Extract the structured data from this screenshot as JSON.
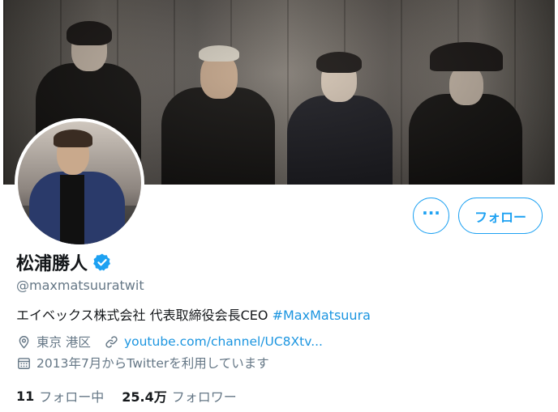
{
  "profile": {
    "display_name": "松浦勝人",
    "handle": "@maxmatsuuratwit",
    "bio_text": "エイベックス株式会社 代表取締役会長CEO ",
    "bio_hashtag": "#MaxMatsuura",
    "location": "東京 港区",
    "url": "youtube.com/channel/UC8Xtv...",
    "joined": "2013年7月からTwitterを利用しています"
  },
  "actions": {
    "more_label": "···",
    "follow_label": "フォロー"
  },
  "stats": {
    "following_count": "11",
    "following_label": "フォロー中",
    "followers_count": "25.4万",
    "followers_label": "フォロワー"
  },
  "icons": {
    "verified": "verified-badge-icon",
    "location": "location-pin-icon",
    "link": "link-icon",
    "calendar": "calendar-icon"
  },
  "colors": {
    "accent": "#1da1f2",
    "link": "#1b95e0",
    "secondary_text": "#657786",
    "primary_text": "#14171a"
  }
}
